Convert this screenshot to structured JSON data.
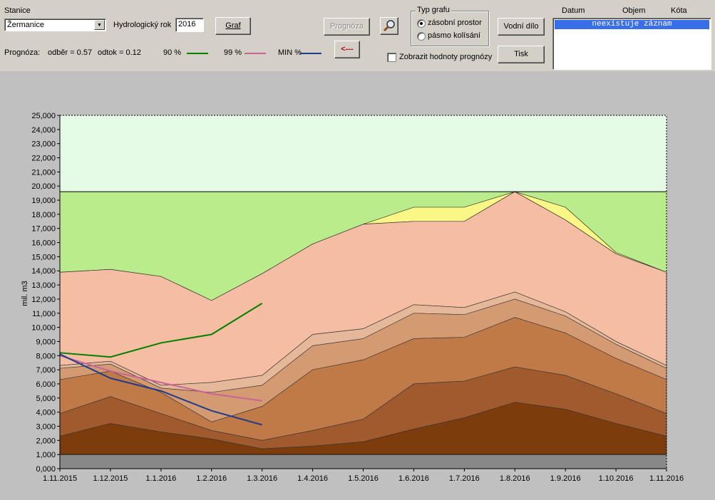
{
  "controls": {
    "station_label": "Stanice",
    "station_value": "Žermanice",
    "hydro_year_label": "Hydrologický rok",
    "hydro_year_value": "2016",
    "graf_button": "Graf",
    "prognoza_button": "Prognóza",
    "back_button": "<---",
    "zoom_icon": "magnifier-icon",
    "graph_type_caption": "Typ grafu",
    "graph_type_options": [
      "zásobní prostor",
      "pásmo kolísání"
    ],
    "graph_type_selected": "zásobní prostor",
    "show_prognosis_label": "Zobrazit hodnoty prognózy",
    "show_prognosis_checked": false,
    "vodni_dilo_button": "Vodní dílo",
    "tisk_button": "Tisk"
  },
  "prognosis": {
    "label": "Prognóza:",
    "odber": "odběr = 0.57",
    "odtok": "odtok = 0.12",
    "legend": [
      {
        "label": "90 %",
        "color": "#008000"
      },
      {
        "label": "99 %",
        "color": "#c86496"
      },
      {
        "label": "MIN %",
        "color": "#1e3c8c"
      }
    ]
  },
  "records": {
    "headers": [
      "Datum",
      "Objem",
      "Kóta"
    ],
    "items": [
      "neexistuje záznam"
    ]
  },
  "chart_data": {
    "type": "area",
    "ylabel": "mil. m3",
    "ylim": [
      0,
      25
    ],
    "yticks": [
      "0,000",
      "1,000",
      "2,000",
      "3,000",
      "4,000",
      "5,000",
      "6,000",
      "7,000",
      "8,000",
      "9,000",
      "10,000",
      "11,000",
      "12,000",
      "13,000",
      "14,000",
      "15,000",
      "16,000",
      "17,000",
      "18,000",
      "19,000",
      "20,000",
      "21,000",
      "22,000",
      "23,000",
      "24,000",
      "25,000"
    ],
    "categories": [
      "1.11.2015",
      "1.12.2015",
      "1.1.2016",
      "1.2.2016",
      "1.3.2016",
      "1.4.2016",
      "1.5.2016",
      "1.6.2016",
      "1.7.2016",
      "1.8.2016",
      "1.9.2016",
      "1.10.2016",
      "1.11.2016"
    ],
    "colors": {
      "flood_zone": "#e6fbe6",
      "controlled_zone": "#bbec8b",
      "band_top": "#fbf787",
      "bands": [
        "#7c3c0c",
        "#a05a2d",
        "#c07a48",
        "#d49a72",
        "#e5b899",
        "#f5bea2"
      ],
      "dead_storage": "#888888"
    },
    "levels": {
      "dead_storage": 1.0,
      "flood_limit": 19.6,
      "total": 25.0
    },
    "upper_band": [
      13.9,
      14.1,
      13.6,
      11.9,
      13.8,
      15.9,
      17.3,
      18.5,
      18.5,
      19.6,
      18.5,
      15.3,
      13.9
    ],
    "ruled_curve": [
      13.9,
      14.1,
      13.6,
      11.9,
      13.8,
      15.9,
      17.3,
      17.5,
      17.5,
      19.6,
      17.6,
      15.2,
      13.9
    ],
    "stacked_bands": [
      [
        2.3,
        3.2,
        2.6,
        2.1,
        1.4,
        1.6,
        1.9,
        2.8,
        3.6,
        4.7,
        4.2,
        3.2,
        2.3
      ],
      [
        3.9,
        5.1,
        3.9,
        2.7,
        2.0,
        2.7,
        3.5,
        6.0,
        6.2,
        7.2,
        6.6,
        5.3,
        3.9
      ],
      [
        6.3,
        6.9,
        5.4,
        3.3,
        4.4,
        7.0,
        7.7,
        9.2,
        9.3,
        10.7,
        9.6,
        7.8,
        6.3
      ],
      [
        7.1,
        7.4,
        5.7,
        5.4,
        5.9,
        8.7,
        9.2,
        11.0,
        10.9,
        12.0,
        10.8,
        8.8,
        7.1
      ],
      [
        7.3,
        7.6,
        5.9,
        6.1,
        6.6,
        9.5,
        9.9,
        11.6,
        11.4,
        12.5,
        11.1,
        9.0,
        7.3
      ]
    ],
    "series": [
      {
        "name": "90 %",
        "color": "#008000",
        "values": [
          8.2,
          7.9,
          8.9,
          9.5,
          11.7
        ]
      },
      {
        "name": "99 %",
        "color": "#c86496",
        "values": [
          8.0,
          6.9,
          6.1,
          5.3,
          4.8
        ]
      },
      {
        "name": "MIN %",
        "color": "#1e3c8c",
        "values": [
          8.1,
          6.4,
          5.5,
          4.1,
          3.1
        ]
      }
    ]
  }
}
